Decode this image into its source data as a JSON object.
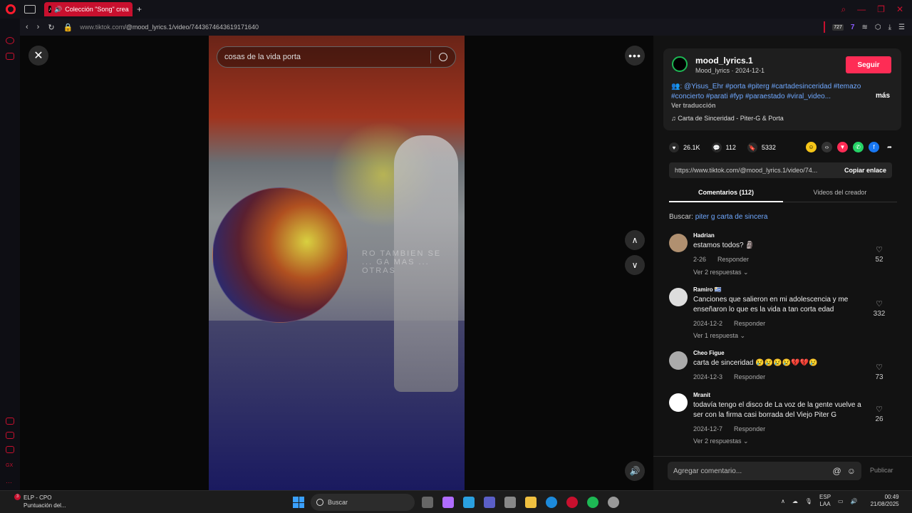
{
  "browser": {
    "tab_title": "Colección \"Song\" crea",
    "url_host": "www.tiktok.com",
    "url_path": "/@mood_lyrics.1/video/7443674643619171640",
    "ext_badge": "727"
  },
  "video": {
    "search_query": "cosas de la vida porta",
    "watermark": "RO TAMBIEN SE ... GA MAS ... OTRAS"
  },
  "post": {
    "username": "mood_lyrics.1",
    "subtitle": "Mood_lyrics · 2024-12-1",
    "follow_label": "Seguir",
    "description": "👥: @Yisus_Ehr #porta #piterg #cartadesinceridad #temazo #concierto #parati #fyp #paraestado #viral_video...",
    "more_label": "más",
    "translate_label": "Ver traducción",
    "song": "♫ Carta de Sinceridad - Piter-G & Porta",
    "likes": "26.1K",
    "comments": "112",
    "saves": "5332",
    "link": "https://www.tiktok.com/@mood_lyrics.1/video/74...",
    "copy_label": "Copiar enlace"
  },
  "tabs": {
    "comments_tab": "Comentarios (112)",
    "creator_tab": "Videos del creador"
  },
  "search_suggestion": {
    "prefix": "Buscar:",
    "query": "piter g carta de sincera"
  },
  "comments": [
    {
      "name": "Hadrian",
      "text": "estamos todos? 🗿",
      "date": "2-26",
      "reply": "Responder",
      "replies": "Ver 2 respuestas ⌄",
      "likes": "52"
    },
    {
      "name": "Ramiro 🇺🇾",
      "text": "Canciones que salieron en mi adolescencia y me enseñaron lo que es la vida a tan corta edad",
      "date": "2024-12-2",
      "reply": "Responder",
      "replies": "Ver 1 respuesta ⌄",
      "likes": "332"
    },
    {
      "name": "Cheo Figue",
      "text": "carta de sinceridad 😢😢😢😢💔💔😢",
      "date": "2024-12-3",
      "reply": "Responder",
      "replies": "",
      "likes": "73"
    },
    {
      "name": "Mranit",
      "text": "todavía tengo el disco de La voz de la gente vuelve a ser con la firma casi borrada del Viejo Piter G",
      "date": "2024-12-7",
      "reply": "Responder",
      "replies": "Ver 2 respuestas ⌄",
      "likes": "26"
    }
  ],
  "compose": {
    "placeholder": "Agregar comentario...",
    "publish_label": "Publicar"
  },
  "taskbar": {
    "notif_count": "3",
    "notif_title": "ELP - CPO",
    "notif_sub": "Puntuación del...",
    "search_label": "Buscar",
    "lang_top": "ESP",
    "lang_bottom": "LAA",
    "time": "00:49",
    "date": "21/08/2025"
  },
  "colors": {
    "opera_red": "#ff1b2d",
    "follow_pink": "#fe2c55",
    "hashtag_blue": "#6fa8ff"
  }
}
